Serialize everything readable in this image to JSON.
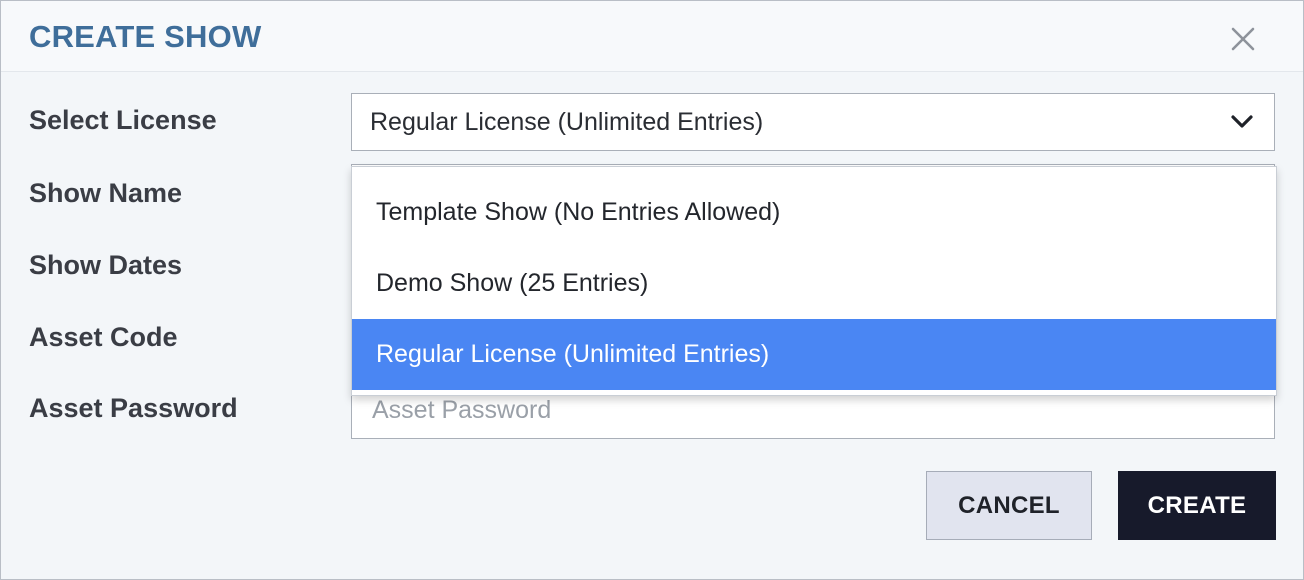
{
  "dialog": {
    "title": "CREATE SHOW",
    "close_icon": "close-icon"
  },
  "form": {
    "license": {
      "label": "Select License",
      "selected_value": "Regular License (Unlimited Entries)",
      "options": [
        {
          "label": "Template Show (No Entries Allowed)"
        },
        {
          "label": "Demo Show (25 Entries)"
        },
        {
          "label": "Regular License (Unlimited Entries)"
        }
      ]
    },
    "show_name": {
      "label": "Show Name"
    },
    "show_dates": {
      "label": "Show Dates"
    },
    "asset_code": {
      "label": "Asset Code"
    },
    "asset_password": {
      "label": "Asset Password",
      "placeholder": "Asset Password",
      "value": ""
    }
  },
  "actions": {
    "cancel_label": "CANCEL",
    "create_label": "CREATE"
  },
  "colors": {
    "title": "#3f6e9a",
    "selected_option": "#4a86f3",
    "create_button": "#171a2b",
    "cancel_button": "#e1e4ef"
  }
}
